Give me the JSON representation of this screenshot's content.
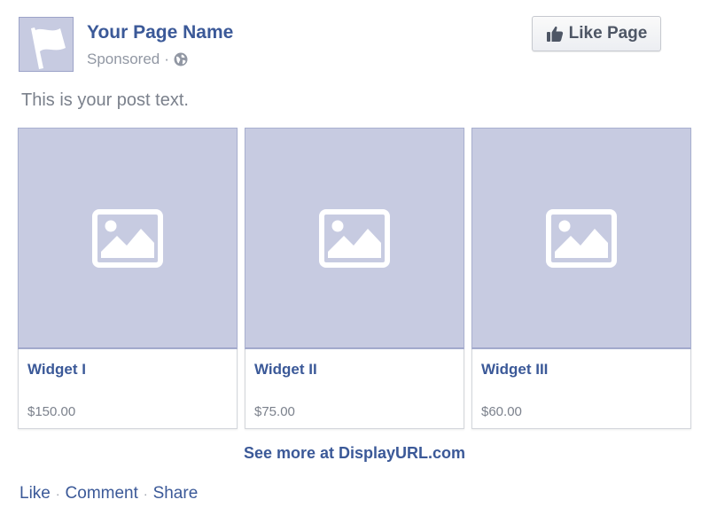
{
  "header": {
    "page_name": "Your Page Name",
    "sponsored_label": "Sponsored",
    "separator": "·",
    "like_page_label": "Like Page"
  },
  "post": {
    "text": "This is your post text."
  },
  "carousel": {
    "cards": [
      {
        "title": "Widget I",
        "price": "$150.00"
      },
      {
        "title": "Widget II",
        "price": "$75.00"
      },
      {
        "title": "Widget III",
        "price": "$60.00"
      }
    ],
    "see_more": "See more at DisplayURL.com"
  },
  "actions": {
    "like": "Like",
    "comment": "Comment",
    "share": "Share",
    "separator": "·"
  },
  "colors": {
    "link_blue": "#3b5998",
    "placeholder_fill": "#c7cbe1",
    "muted_text": "#9197a3"
  },
  "icons": {
    "avatar": "flag-icon",
    "audience": "globe-icon",
    "like_button": "thumbs-up-icon",
    "card_image": "image-placeholder-icon"
  }
}
